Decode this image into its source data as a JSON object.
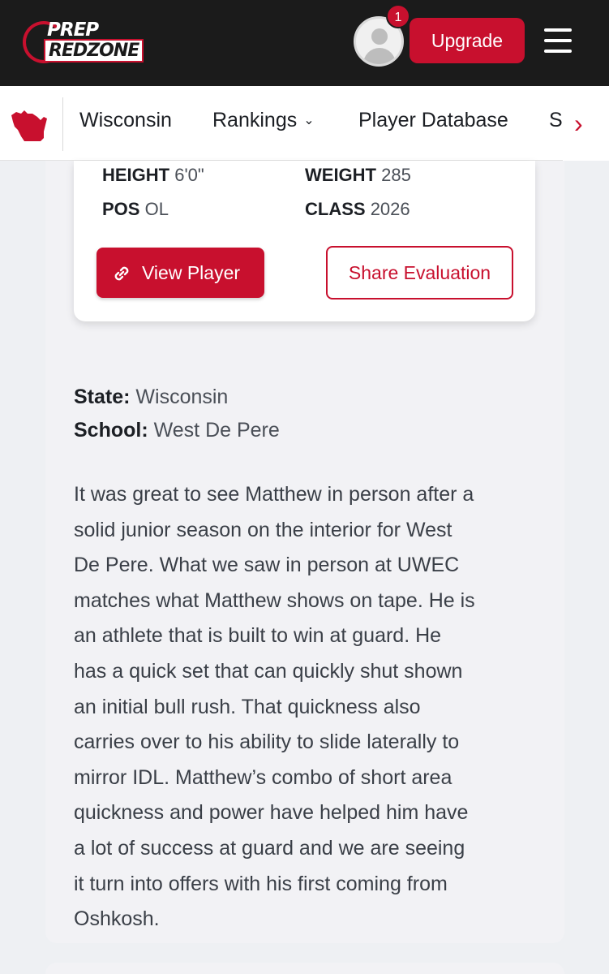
{
  "header": {
    "logo": {
      "line1": "PREP",
      "line2": "REDZONE"
    },
    "notification_count": "1",
    "upgrade_label": "Upgrade"
  },
  "nav": {
    "items": [
      "Wisconsin",
      "Rankings",
      "Player Database",
      "S"
    ],
    "rankings_chevron": "⌄",
    "next_arrow": "›"
  },
  "player": {
    "height_label": "HEIGHT",
    "height_value": "6'0\"",
    "weight_label": "WEIGHT",
    "weight_value": "285",
    "pos_label": "POS",
    "pos_value": "OL",
    "class_label": "CLASS",
    "class_value": "2026",
    "view_button": "View Player",
    "share_button": "Share Evaluation"
  },
  "details": {
    "state_label": "State:",
    "state_value": "Wisconsin",
    "school_label": "School:",
    "school_value": "West De Pere"
  },
  "evaluation_lines": [
    "It was great to see Matthew in person after a",
    "solid junior season on the interior for West",
    "De Pere. What we saw in person at UWEC",
    "matches what Matthew shows on tape. He is",
    "an athlete that is built to win at guard. He",
    "has a quick set that can quickly shut shown",
    "an initial bull rush. That quickness also",
    "carries over to his ability to slide laterally to",
    "mirror IDL. Matthew’s combo of short area",
    "quickness and power have helped him have",
    "a lot of success at guard and we are seeing",
    "it turn into offers with his first coming from",
    "Oshkosh."
  ],
  "colors": {
    "brand_red": "#c8102e",
    "topbar": "#1b1b1b",
    "panel": "#f2f2f5"
  }
}
